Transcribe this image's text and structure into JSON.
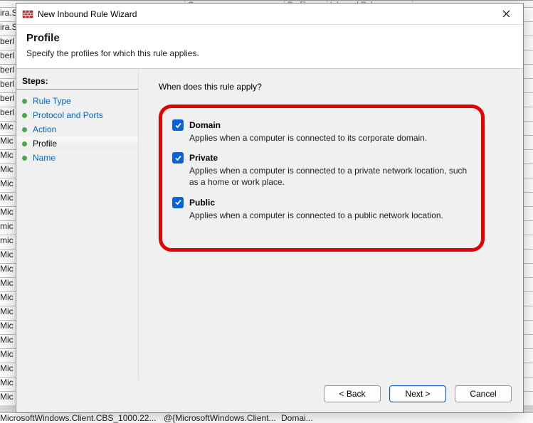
{
  "bg": {
    "top_headers": [
      "",
      "Group",
      "Profile",
      "Inbound Rules"
    ],
    "rows": [
      "ira.S",
      "ira.S",
      "berl",
      "berl",
      "berl",
      "berl",
      "berl",
      "berl",
      "Mic",
      "Mic",
      "Mic",
      "Mic",
      "Mic",
      "Mic",
      "Mic",
      "mic",
      "mic",
      "Mic",
      "Mic",
      "Mic",
      "Mic",
      "Mic",
      "Mic",
      "Mic",
      "Mic",
      "Mic",
      "Mic",
      "Mic"
    ],
    "bottom_cells": [
      "MicrosoftWindows.Client.CBS_1000.22...",
      "@{MicrosoftWindows.Client...",
      "Domai..."
    ]
  },
  "dialog": {
    "title": "New Inbound Rule Wizard",
    "header": {
      "title": "Profile",
      "subtitle": "Specify the profiles for which this rule applies."
    },
    "steps": {
      "heading": "Steps:",
      "items": [
        {
          "label": "Rule Type",
          "bullet": "#4aa64a"
        },
        {
          "label": "Protocol and Ports",
          "bullet": "#4aa64a"
        },
        {
          "label": "Action",
          "bullet": "#4aa64a"
        },
        {
          "label": "Profile",
          "bullet": "#4aa64a",
          "current": true
        },
        {
          "label": "Name",
          "bullet": "#4aa64a"
        }
      ]
    },
    "content": {
      "question": "When does this rule apply?",
      "options": [
        {
          "label": "Domain",
          "checked": true,
          "desc": "Applies when a computer is connected to its corporate domain."
        },
        {
          "label": "Private",
          "checked": true,
          "desc": "Applies when a computer is connected to a private network location, such as a home or work place."
        },
        {
          "label": "Public",
          "checked": true,
          "desc": "Applies when a computer is connected to a public network location."
        }
      ]
    },
    "buttons": {
      "back": "< Back",
      "next": "Next >",
      "cancel": "Cancel"
    }
  }
}
